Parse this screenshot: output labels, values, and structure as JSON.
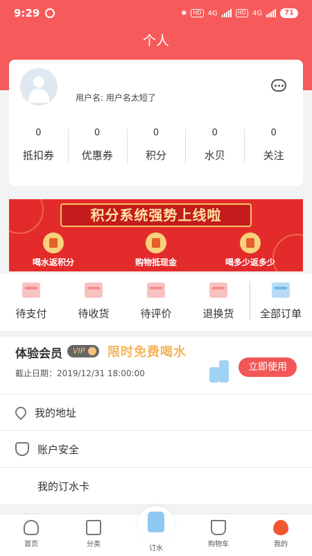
{
  "status_bar": {
    "time": "9:29",
    "battery": "71",
    "network_a": "4G",
    "network_b": "4G",
    "hd_a": "HD",
    "hd_b": "HD"
  },
  "header": {
    "title": "个人"
  },
  "profile": {
    "username": "用户名: 用户名太短了",
    "stats": [
      {
        "value": "0",
        "label": "抵扣券"
      },
      {
        "value": "0",
        "label": "优惠券"
      },
      {
        "value": "0",
        "label": "积分"
      },
      {
        "value": "0",
        "label": "水贝"
      },
      {
        "value": "0",
        "label": "关注"
      }
    ]
  },
  "banner": {
    "headline": "积分系统强势上线啦",
    "items": [
      "喝水返积分",
      "购物抵现金",
      "喝多少返多少"
    ]
  },
  "orders": [
    {
      "label": "待支付"
    },
    {
      "label": "待收货"
    },
    {
      "label": "待评价"
    },
    {
      "label": "退换货"
    },
    {
      "label": "全部订单"
    }
  ],
  "member": {
    "title": "体验会员",
    "badge": "VIP",
    "promo": "限时免费喝水",
    "deadline": "截止日期：2019/12/31 18:00:00",
    "button": "立即使用"
  },
  "menu": [
    {
      "label": "我的地址",
      "icon": "location-pin-icon"
    },
    {
      "label": "账户安全",
      "icon": "shield-check-icon"
    },
    {
      "label": "我的订水卡",
      "icon": "vip-card-icon"
    }
  ],
  "tabbar": [
    {
      "label": "首页",
      "icon": "home-icon"
    },
    {
      "label": "分类",
      "icon": "category-icon"
    },
    {
      "label": "订水",
      "icon": "water-bottle-icon"
    },
    {
      "label": "购物车",
      "icon": "cart-icon"
    },
    {
      "label": "我的",
      "icon": "water-drop-icon"
    }
  ],
  "colors": {
    "primary": "#f65a5a",
    "promo": "#f6b45a",
    "button": "#f25656"
  }
}
